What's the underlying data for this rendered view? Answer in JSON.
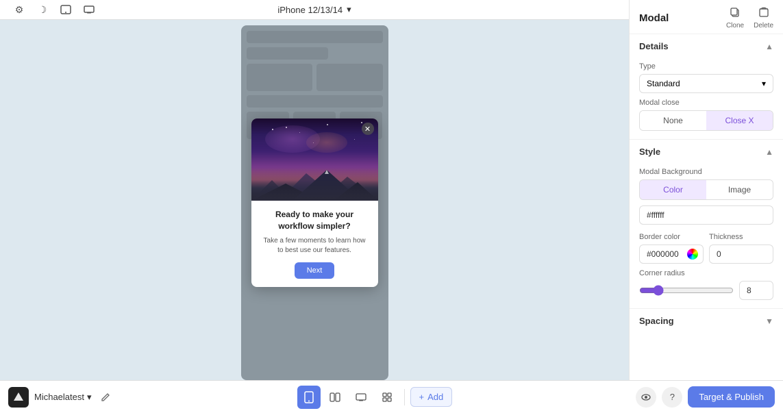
{
  "header": {
    "panel_title": "Modal",
    "clone_label": "Clone",
    "delete_label": "Delete"
  },
  "device_toolbar": {
    "device_name": "iPhone 12/13/14",
    "icons": [
      "settings",
      "moon",
      "tablet",
      "desktop"
    ]
  },
  "details_section": {
    "title": "Details",
    "type_label": "Type",
    "type_value": "Standard",
    "modal_close_label": "Modal close",
    "modal_close_options": [
      "None",
      "Close X"
    ],
    "modal_close_selected": "Close X"
  },
  "style_section": {
    "title": "Style",
    "modal_bg_label": "Modal Background",
    "modal_bg_options": [
      "Color",
      "Image"
    ],
    "modal_bg_selected": "Color",
    "bg_color_value": "#ffffff",
    "border_color_label": "Border color",
    "border_color_value": "#000000",
    "thickness_label": "Thickness",
    "thickness_value": "0",
    "corner_radius_label": "Corner radius",
    "corner_radius_value": "8",
    "corner_radius_slider_min": 0,
    "corner_radius_slider_max": 50,
    "corner_radius_slider_current": 8
  },
  "spacing_section": {
    "title": "Spacing"
  },
  "modal_content": {
    "title": "Ready to make your workflow simpler?",
    "description": "Take a few moments to learn how to best use our features.",
    "button_label": "Next"
  },
  "bottom_bar": {
    "workspace_name": "Michaelatest",
    "add_label": "Add",
    "target_publish_label": "Target & Publish"
  }
}
